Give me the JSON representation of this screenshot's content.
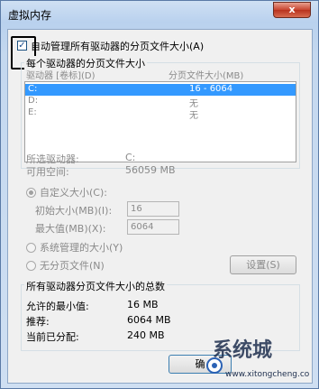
{
  "window": {
    "title": "虚拟内存",
    "close_label": "x"
  },
  "auto_manage": {
    "checked": true,
    "check_glyph": "✓",
    "label": "自动管理所有驱动器的分页文件大小(A)"
  },
  "per_drive": {
    "group_label": "每个驱动器的分页文件大小",
    "columns": [
      "驱动器 [卷标](D)",
      "分页文件大小(MB)"
    ],
    "rows": [
      {
        "drive": "C:",
        "size": "16 - 6064",
        "selected": true
      },
      {
        "drive": "D:",
        "size": "无",
        "selected": false
      },
      {
        "drive": "E:",
        "size": "无",
        "selected": false
      }
    ]
  },
  "selected_drive": {
    "label": "所选驱动器:",
    "value": "C:",
    "free_label": "可用空间:",
    "free_value": "56059 MB"
  },
  "custom_size": {
    "label": "自定义大小(C):",
    "initial_label": "初始大小(MB)(I):",
    "initial_value": "16",
    "max_label": "最大值(MB)(X):",
    "max_value": "6064"
  },
  "system_managed": {
    "label": "系统管理的大小(Y)"
  },
  "no_paging": {
    "label": "无分页文件(N)"
  },
  "set_button": {
    "label": "设置(S)"
  },
  "totals": {
    "group_label": "所有驱动器分页文件大小的总数",
    "min_label": "允许的最小值:",
    "min_value": "16 MB",
    "rec_label": "推荐:",
    "rec_value": "6064 MB",
    "cur_label": "当前已分配:",
    "cur_value": "240 MB"
  },
  "ok_button": {
    "label": "确"
  },
  "watermark": {
    "text": "系统城",
    "url": "www.xitongcheng.com"
  }
}
